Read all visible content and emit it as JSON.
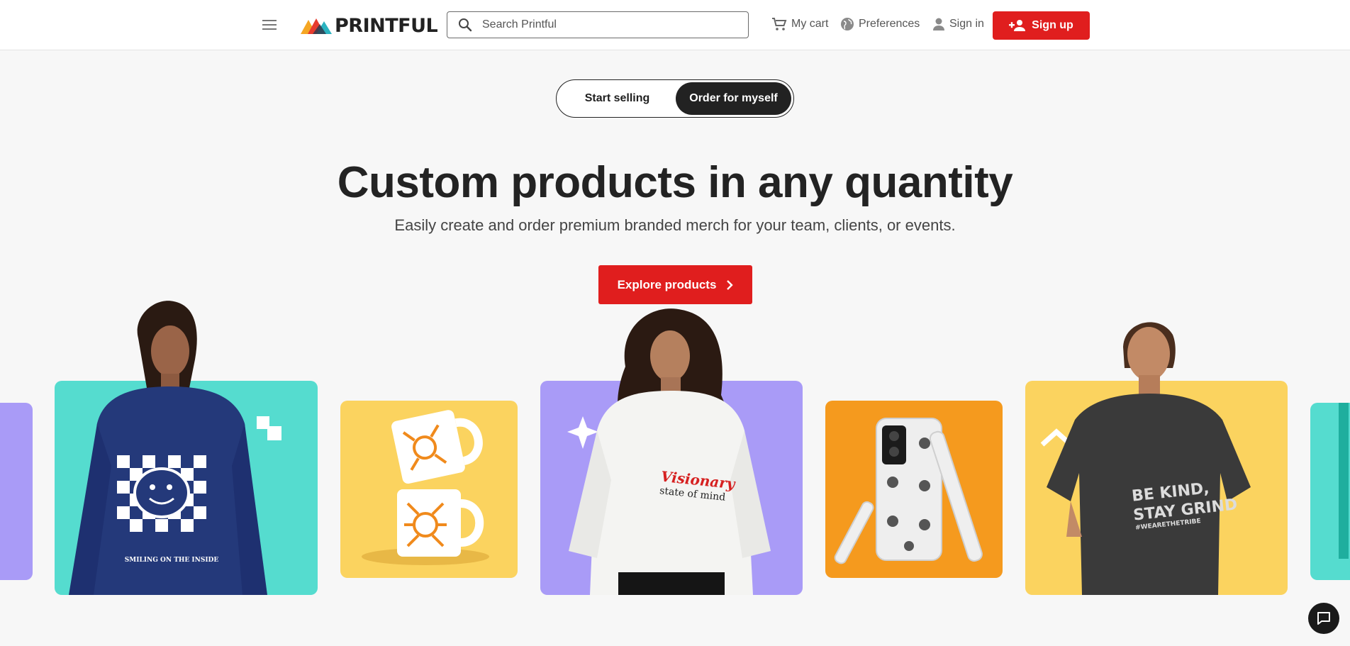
{
  "header": {
    "menu_icon": "hamburger-menu-icon",
    "logo_text": "PRINTFUL",
    "search": {
      "placeholder": "Search Printful",
      "icon": "search-icon"
    },
    "cart_label": "My cart",
    "preferences_label": "Preferences",
    "signin_label": "Sign in",
    "signup_label": "Sign up"
  },
  "toggle": {
    "start_selling": "Start selling",
    "order_for_myself": "Order for myself",
    "selected": "Order for myself"
  },
  "hero": {
    "title": "Custom products in any quantity",
    "subtitle": "Easily create and order premium branded merch for your team, clients, or events.",
    "cta_label": "Explore products"
  },
  "products": {
    "sweatshirt_print": "SMILING ON THE INSIDE",
    "crewneck_print_1": "Visionary",
    "crewneck_print_2": "state of mind",
    "tee_print_1": "BE KIND,",
    "tee_print_2": "STAY GRIND",
    "tee_print_3": "#WEARETHETRIBE"
  },
  "colors": {
    "brand_red": "#e01e1e",
    "teal": "#55dccf",
    "yellow": "#fbd35f",
    "purple": "#a99bf7",
    "orange": "#f59a1e"
  },
  "chat_icon": "chat-bubble-icon"
}
